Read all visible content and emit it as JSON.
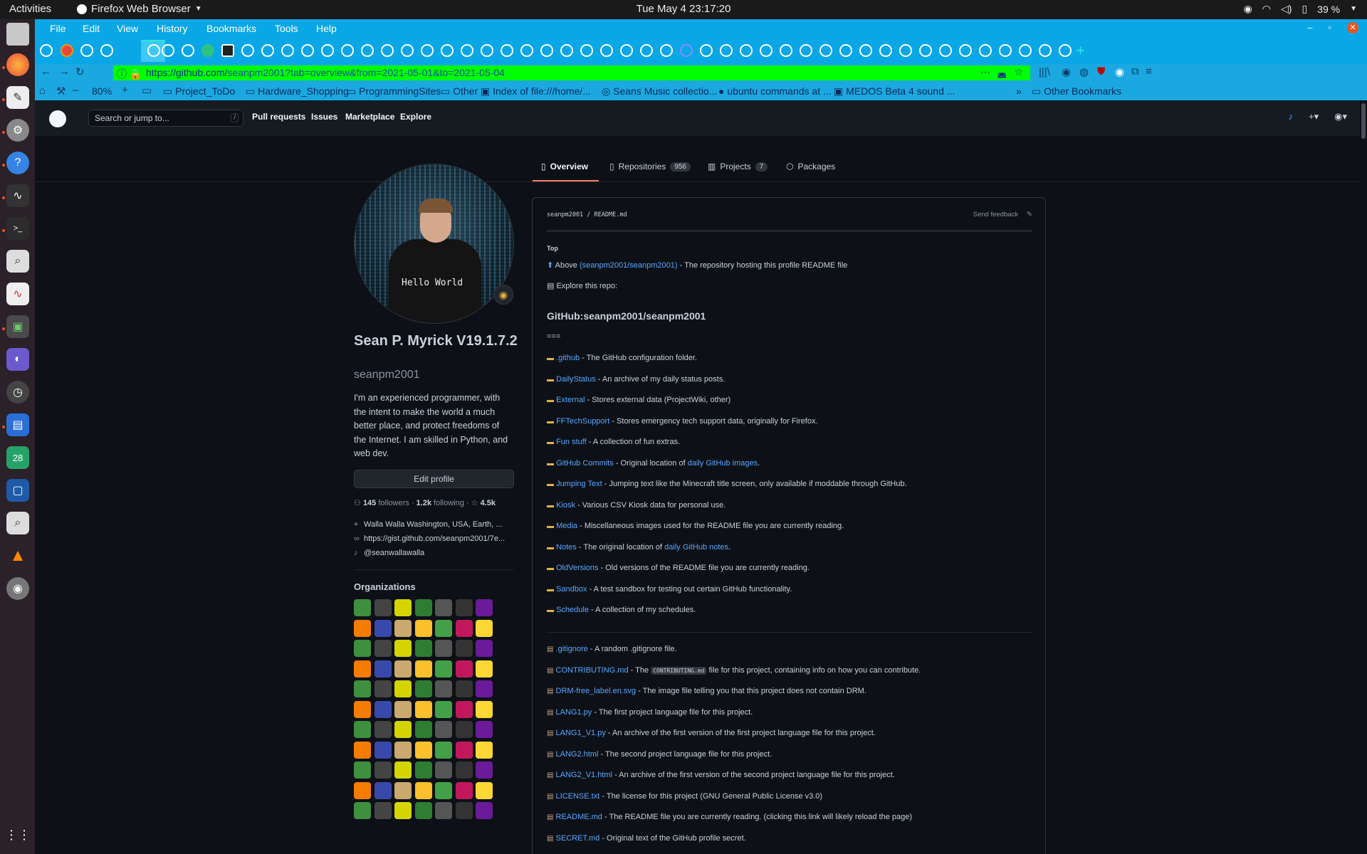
{
  "os": {
    "activities": "Activities",
    "app_name": "Firefox Web Browser",
    "clock": "Tue May 4  23:17:20",
    "battery": "39 %"
  },
  "browser": {
    "menu": [
      "File",
      "Edit",
      "View",
      "History",
      "Bookmarks",
      "Tools",
      "Help"
    ],
    "url_host": "https://github.com/",
    "url_path": "seanpm2001?tab=overview&from=2021-05-01&to=2021-05-04",
    "zoom": "80%",
    "bookmarks": [
      "Project_ToDo",
      "Hardware_Shopping",
      "ProgrammingSites",
      "Other",
      "Index of file:///home/...",
      "Seans Music collectio...",
      "ubuntu commands at ...",
      "MEDOS Beta 4 sound ..."
    ],
    "other_bookmarks": "Other Bookmarks"
  },
  "github": {
    "search_placeholder": "Search or jump to...",
    "search_key": "/",
    "nav": [
      "Pull requests",
      "Issues",
      "Marketplace",
      "Explore"
    ],
    "tabs": [
      {
        "label": "Overview",
        "count": ""
      },
      {
        "label": "Repositories",
        "count": "956"
      },
      {
        "label": "Projects",
        "count": "7"
      },
      {
        "label": "Packages",
        "count": ""
      }
    ]
  },
  "profile": {
    "shirt_text": "Hello World",
    "name": "Sean P. Myrick V19.1.7.2",
    "login": "seanpm2001",
    "bio": "I'm an experienced programmer, with the intent to make the world a much better place, and protect freedoms of the Internet. I am skilled in Python, and web dev.",
    "edit_button": "Edit profile",
    "followers": "145",
    "followers_label": "followers",
    "following": "1.2k",
    "following_label": "following",
    "stars": "4.5k",
    "location": "Walla Walla Washington, USA, Earth, ...",
    "website": "https://gist.github.com/seanpm2001/7e...",
    "twitter": "@seanwallawalla",
    "orgs_title": "Organizations"
  },
  "readme": {
    "owner": "seanpm2001",
    "file": "README.md",
    "feedback": "Send feedback",
    "top": "Top",
    "above_prefix": "Above",
    "above_link": "(seanpm2001/seanpm2001)",
    "above_suffix": "- The repository hosting this profile README file",
    "explore": "Explore this repo:",
    "heading": "GitHub:seanpm2001/seanpm2001",
    "eqs": "===",
    "folders": [
      {
        "name": ".github",
        "desc": "- The GitHub configuration folder.",
        "link2": ""
      },
      {
        "name": "DailyStatus",
        "desc": "- An archive of my daily status posts.",
        "link2": ""
      },
      {
        "name": "External",
        "desc": "- Stores external data (ProjectWiki, other)",
        "link2": ""
      },
      {
        "name": "FFTechSupport",
        "desc": "- Stores emergency tech support data, originally for Firefox.",
        "link2": ""
      },
      {
        "name": "Fun stuff",
        "desc": "- A collection of fun extras.",
        "link2": ""
      },
      {
        "name": "GitHub Commits",
        "desc": "- Original location of",
        "link2": "daily GitHub images",
        "tail": "."
      },
      {
        "name": "Jumping Text",
        "desc": "- Jumping text like the Minecraft title screen, only available if moddable through GitHub.",
        "link2": ""
      },
      {
        "name": "Kiosk",
        "desc": "- Various CSV Kiosk data for personal use.",
        "link2": ""
      },
      {
        "name": "Media",
        "desc": "- Miscellaneous images used for the README file you are currently reading.",
        "link2": ""
      },
      {
        "name": "Notes",
        "desc": "- The original location of",
        "link2": "daily GitHub notes",
        "tail": "."
      },
      {
        "name": "OldVersions",
        "desc": "- Old versions of the README file you are currently reading.",
        "link2": ""
      },
      {
        "name": "Sandbox",
        "desc": "- A test sandbox for testing out certain GitHub functionality.",
        "link2": ""
      },
      {
        "name": "Schedule",
        "desc": "- A collection of my schedules.",
        "link2": ""
      }
    ],
    "files": [
      {
        "name": ".gitignore",
        "desc": "- A random .gitignore file."
      },
      {
        "name": "CONTRIBUTING.md",
        "desc_pre": "- The",
        "code": "CONTRIBUTING.md",
        "desc": "file for this project, containing info on how you can contribute."
      },
      {
        "name": "DRM-free_label.en.svg",
        "desc": "- The image file telling you that this project does not contain DRM."
      },
      {
        "name": "LANG1.py",
        "desc": "- The first project language file for this project."
      },
      {
        "name": "LANG1_V1.py",
        "desc": "- An archive of the first version of the first project language file for this project."
      },
      {
        "name": "LANG2.html",
        "desc": "- The second project language file for this project."
      },
      {
        "name": "LANG2_V1.html",
        "desc": "- An archive of the first version of the second project language file for this project."
      },
      {
        "name": "LICENSE.txt",
        "desc": "- The license for this project (GNU General Public License v3.0)"
      },
      {
        "name": "README.md",
        "desc": "- The README file you are currently reading. (clicking this link will likely reload the page)"
      },
      {
        "name": "SECRET.md",
        "desc": "- Original text of the GitHub profile secret."
      }
    ]
  }
}
